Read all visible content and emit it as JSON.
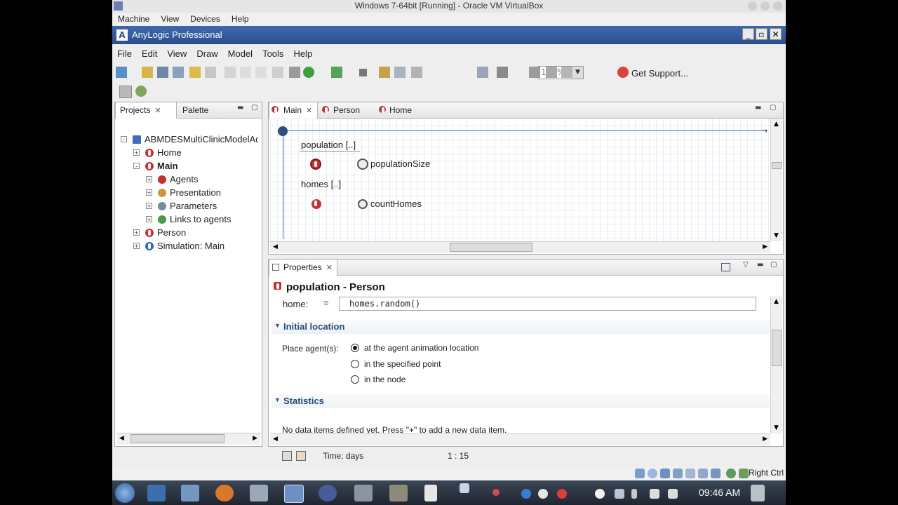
{
  "vbox": {
    "title": "Windows 7-64bit [Running] - Oracle VM VirtualBox",
    "menu": [
      "Machine",
      "View",
      "Devices",
      "Help"
    ],
    "host_key": "Right Ctrl"
  },
  "app": {
    "title": "AnyLogic Professional",
    "menu": [
      "File",
      "Edit",
      "View",
      "Draw",
      "Model",
      "Tools",
      "Help"
    ],
    "zoom": "100%",
    "get_support": "Get Support..."
  },
  "projects": {
    "tabs": [
      "Projects",
      "Palette"
    ],
    "tree": [
      {
        "label": "ABMDESMultiClinicModelAdelai",
        "level": 0,
        "exp": "-",
        "icon": "model-icon"
      },
      {
        "label": "Home",
        "level": 1,
        "exp": "+",
        "icon": "agent-icon"
      },
      {
        "label": "Main",
        "level": 1,
        "exp": "-",
        "icon": "agent-icon"
      },
      {
        "label": "Agents",
        "level": 2,
        "exp": "+",
        "icon": "agents-icon"
      },
      {
        "label": "Presentation",
        "level": 2,
        "exp": "+",
        "icon": "presentation-icon"
      },
      {
        "label": "Parameters",
        "level": 2,
        "exp": "+",
        "icon": "parameters-icon"
      },
      {
        "label": "Links to agents",
        "level": 2,
        "exp": "+",
        "icon": "links-icon"
      },
      {
        "label": "Person",
        "level": 1,
        "exp": "+",
        "icon": "agent-icon"
      },
      {
        "label": "Simulation: Main",
        "level": 1,
        "exp": "+",
        "icon": "simulation-icon"
      }
    ]
  },
  "editor": {
    "tabs": [
      "Main",
      "Person",
      "Home"
    ],
    "items": {
      "population": "population [..]",
      "population_size": "populationSize",
      "homes": "homes [..]",
      "count_homes": "countHomes"
    }
  },
  "properties": {
    "tab": "Properties",
    "title": "population - Person",
    "home_label": "home:",
    "home_eq": "=",
    "home_value": "homes.random()",
    "section_initial": "Initial location",
    "place_label": "Place agent(s):",
    "options": [
      "at the agent animation location",
      "in the specified point",
      "in the node"
    ],
    "selected_option": 0,
    "section_stats": "Statistics",
    "stats_msg": "No data items defined yet. Press \"+\" to add a new data item."
  },
  "status": {
    "time": "Time: days",
    "scale": "1 : 15"
  },
  "taskbar": {
    "clock": "09:46 AM"
  }
}
